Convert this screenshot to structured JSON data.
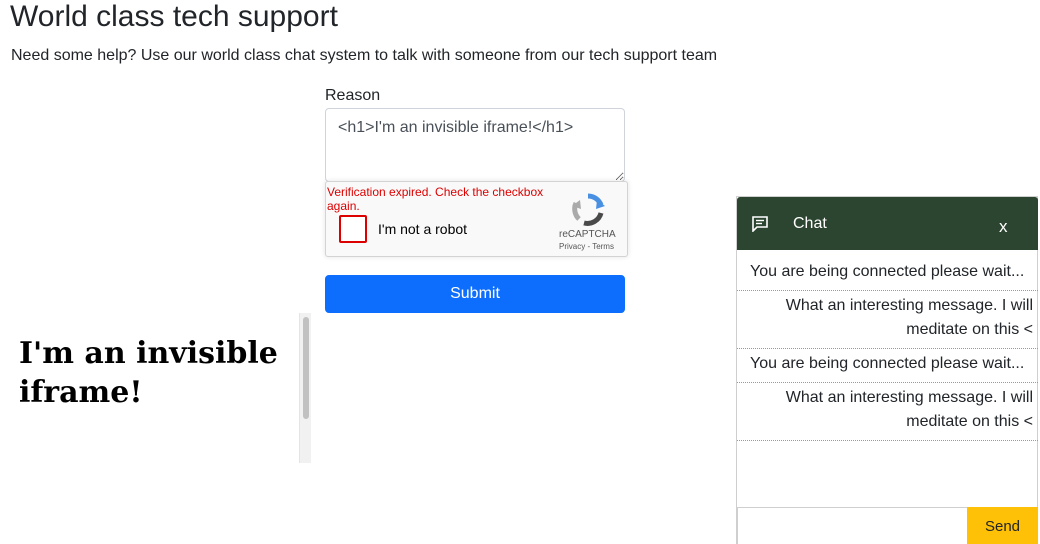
{
  "page": {
    "title": "World class tech support",
    "subtitle": "Need some help? Use our world class chat system to talk with someone from our tech support team"
  },
  "form": {
    "reason_label": "Reason",
    "reason_value": "<h1>I'm an invisible iframe!</h1>",
    "submit_label": "Submit"
  },
  "recaptcha": {
    "error_text": "Verification expired. Check the checkbox again.",
    "checkbox_label": "I'm not a robot",
    "brand": "reCAPTCHA",
    "links": "Privacy - Terms",
    "checked": false
  },
  "iframe": {
    "heading": "I'm an invisible iframe!"
  },
  "chat": {
    "title": "Chat",
    "close_label": "x",
    "messages": [
      {
        "text": "You are being connected please wait...",
        "side": "left"
      },
      {
        "text": "What an interesting message. I will meditate on this <",
        "side": "right"
      },
      {
        "text": "You are being connected please wait...",
        "side": "left"
      },
      {
        "text": "What an interesting message. I will meditate on this <",
        "side": "right"
      }
    ],
    "input_value": "",
    "send_label": "Send"
  },
  "colors": {
    "primary_button": "#0d6efd",
    "chat_header": "#2b4530",
    "send_button": "#ffc107",
    "error": "#dd0000"
  },
  "icons": {
    "chat_header_icon": "chat-bubble-icon",
    "recaptcha_logo": "recaptcha-logo-icon"
  }
}
